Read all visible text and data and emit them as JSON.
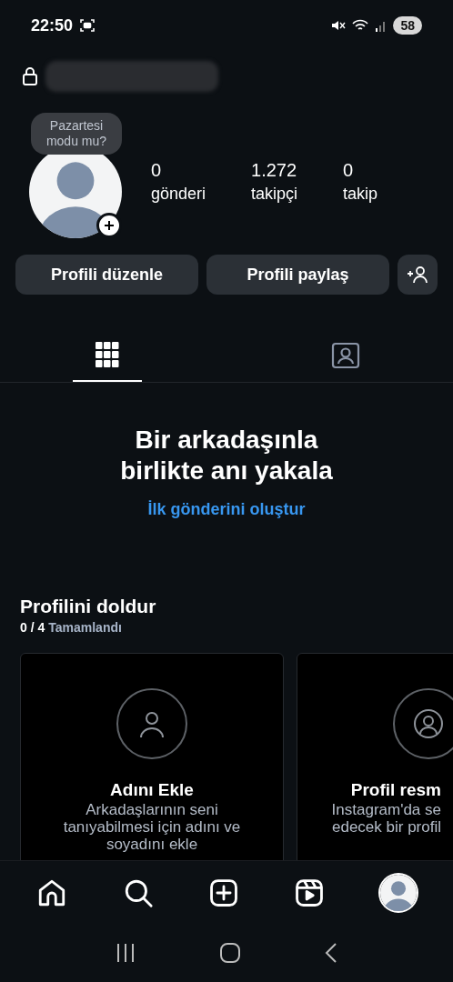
{
  "status_bar": {
    "time": "22:50",
    "battery": "58"
  },
  "profile": {
    "tooltip": "Pazartesi modu mu?",
    "stats": [
      {
        "value": "0",
        "label": "gönderi"
      },
      {
        "value": "1.272",
        "label": "takipçi"
      },
      {
        "value": "0",
        "label": "takip"
      }
    ]
  },
  "actions": [
    "Profili düzenle",
    "Profili paylaş"
  ],
  "tabs": [
    {
      "kind": "grid",
      "selected": true
    },
    {
      "kind": "tagged",
      "selected": false
    }
  ],
  "empty_state": {
    "title": "Bir arkadaşınla birlikte anı yakala",
    "link": "İlk gönderini oluştur"
  },
  "complete_profile": {
    "title": "Profilini doldur",
    "count": "0 / 4",
    "progress_label": "Tamamlandı",
    "cards": [
      {
        "kind": "name",
        "title": "Adını Ekle",
        "lines": [
          "Arkadaşlarının seni",
          "tanıyabilmesi için adını ve",
          "soyadını ekle"
        ]
      },
      {
        "title": "Profil resm",
        "lines": [
          "Instagram'da se",
          "edecek bir profil"
        ]
      }
    ]
  },
  "bottom_nav": [
    {
      "kind": "home",
      "selected": false
    },
    {
      "kind": "search",
      "selected": false
    },
    {
      "kind": "create",
      "selected": false
    },
    {
      "kind": "reels",
      "selected": false
    },
    {
      "kind": "profile",
      "selected": true
    }
  ]
}
